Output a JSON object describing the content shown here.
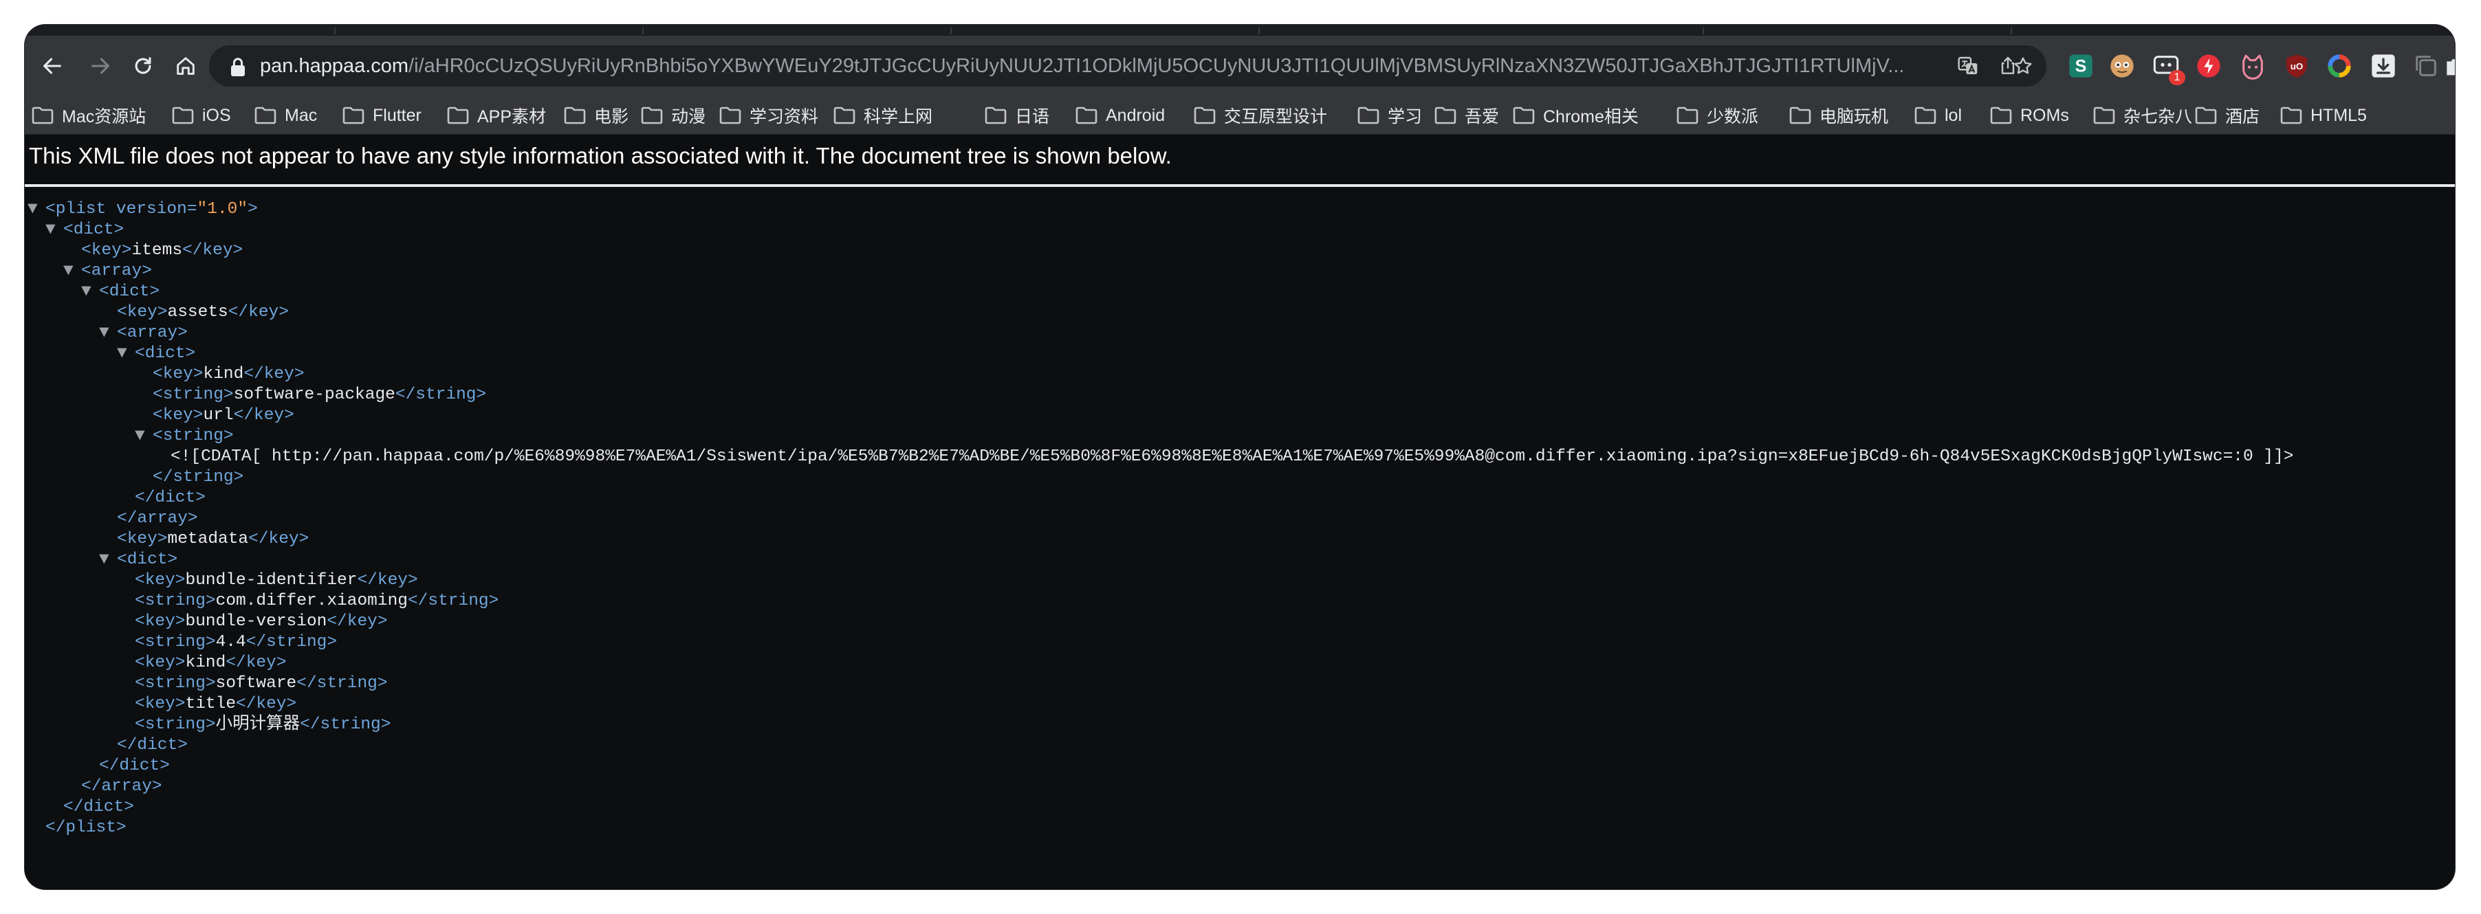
{
  "browser": {
    "url_host": "pan.happaa.com",
    "url_rest": "/i/aHR0cCUzQSUyRiUyRnBhbi5oYXBwYWEuY29tJTJGcCUyRiUyNUU2JTI1ODklMjU5OCUyNUU3JTI1QUUlMjVBMSUyRlNzaXN3ZW50JTJGaXBhJTJGJTI1RTUlMjV...",
    "badge_count": "1"
  },
  "bookmarks": [
    "Mac资源站",
    "iOS",
    "Mac",
    "Flutter",
    "APP素材",
    "电影",
    "动漫",
    "学习资料",
    "科学上网",
    "日语",
    "Android",
    "交互原型设计",
    "学习",
    "吾爱",
    "Chrome相关",
    "少数派",
    "电脑玩机",
    "lol",
    "ROMs",
    "杂七杂八",
    "酒店",
    "HTML5"
  ],
  "notice": "This XML file does not appear to have any style information associated with it. The document tree is shown below.",
  "xml": {
    "plist_open": "<plist",
    "version_attr": "version=",
    "version_value": "\"1.0\"",
    "plist_open_end": ">",
    "plist_close": "</plist>",
    "dict_open": "<dict>",
    "dict_close": "</dict>",
    "array_open": "<array>",
    "array_close": "</array>",
    "key_open": "<key>",
    "key_close": "</key>",
    "string_open": "<string>",
    "string_close": "</string>",
    "toggle": "▼",
    "key_items": "items",
    "key_assets": "assets",
    "key_kind": "kind",
    "val_software_package": "software-package",
    "key_url": "url",
    "cdata": "<![CDATA[ http://pan.happaa.com/p/%E6%89%98%E7%AE%A1/Ssiswent/ipa/%E5%B7%B2%E7%AD%BE/%E5%B0%8F%E6%98%8E%E8%AE%A1%E7%AE%97%E5%99%A8@com.differ.xiaoming.ipa?sign=x8EFuejBCd9-6h-Q84v5ESxagKCK0dsBjgQPlyWIswc=:0 ]]>",
    "key_metadata": "metadata",
    "key_bundle_identifier": "bundle-identifier",
    "val_bundle_id": "com.differ.xiaoming",
    "key_bundle_version": "bundle-version",
    "val_version": "4.4",
    "val_software": "software",
    "key_title": "title",
    "val_title": "小明计算器"
  },
  "colors": {
    "tag": "#6ea6dc",
    "attribute_value": "#f0a45d",
    "text": "#e8eaed",
    "background": "#0d0e10",
    "toolbar": "#35363a"
  }
}
